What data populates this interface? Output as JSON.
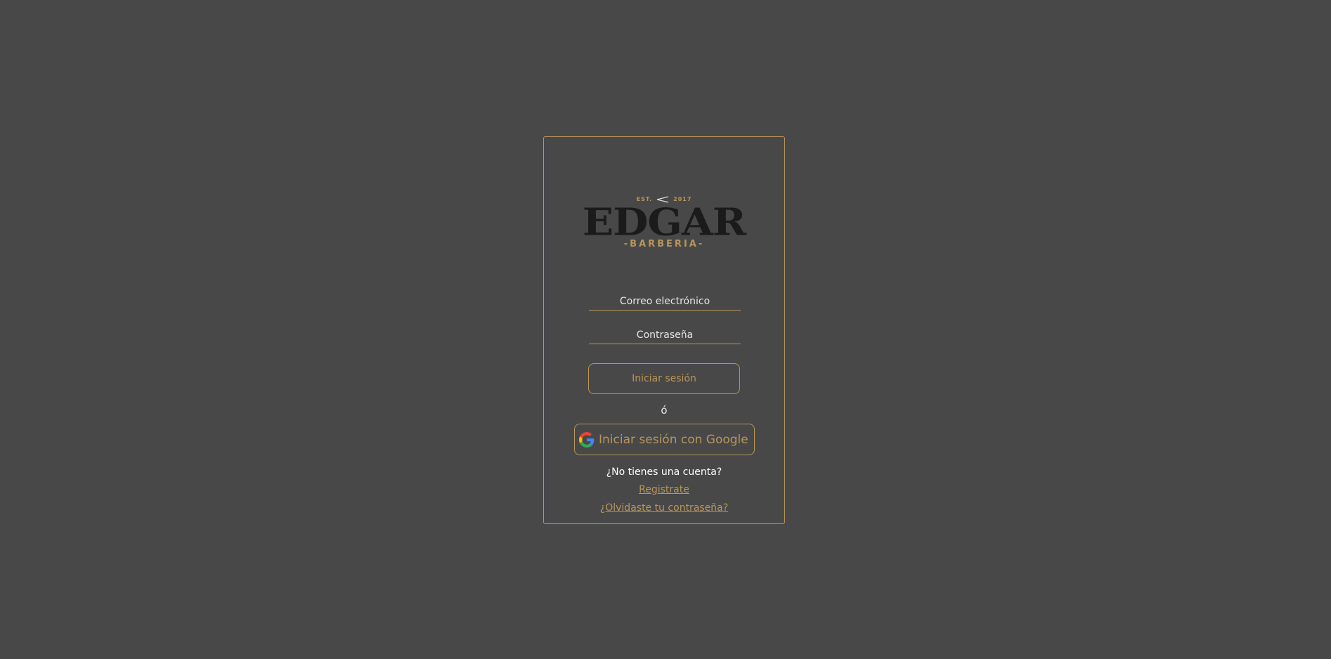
{
  "logo": {
    "est_left": "EST.",
    "est_right": "2017",
    "brand": "EDGAR",
    "subtitle": "-BARBERIA-"
  },
  "form": {
    "email_placeholder": "Correo electrónico",
    "password_placeholder": "Contraseña",
    "login_label": "Iniciar sesión",
    "or_label": "ó",
    "google_label": "Iniciar sesión con Google"
  },
  "footer": {
    "no_account": "¿No tienes una cuenta?",
    "register_link": "Registrate",
    "forgot_link": "¿Olvidaste tu contraseña?"
  },
  "colors": {
    "background": "#484848",
    "accent": "#b8955a",
    "logo_dark": "#1b1b1b"
  }
}
